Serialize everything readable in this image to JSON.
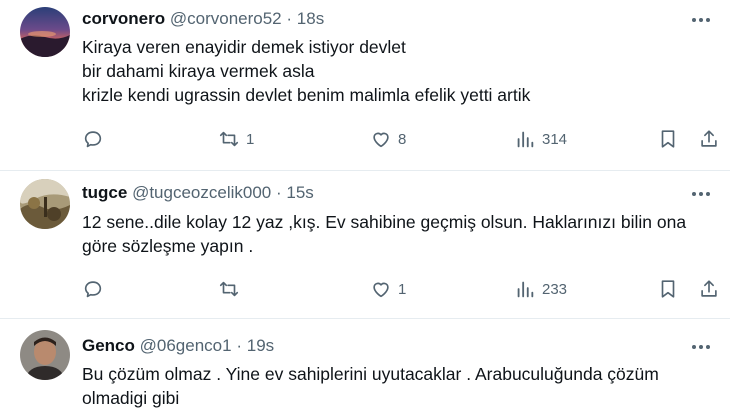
{
  "tweets": [
    {
      "name": "corvonero",
      "handle": "@corvonero52",
      "separator": "·",
      "time": "18s",
      "lines": [
        "Kiraya veren enayidir demek istiyor devlet",
        "bir dahami kiraya vermek asla",
        "krizle kendi ugrassin devlet benim malimla efelik yetti artik"
      ],
      "reply_count": "",
      "retweet_count": "1",
      "like_count": "8",
      "view_count": "314"
    },
    {
      "name": "tugce",
      "handle": "@tugceozcelik000",
      "separator": "·",
      "time": "15s",
      "text": "12 sene..dile kolay 12 yaz ,kış. Ev sahibine geçmiş olsun. Haklarınızı bilin ona göre sözleşme yapın .",
      "reply_count": "",
      "retweet_count": "",
      "like_count": "1",
      "view_count": "233"
    },
    {
      "name": "Genco",
      "handle": "@06genco1",
      "separator": "·",
      "time": "19s",
      "text": "Bu çözüm olmaz . Yine ev sahiplerini uyutacaklar . Arabuculuğunda çözüm olmadigi gibi"
    }
  ],
  "icons": {
    "reply": "reply-icon",
    "retweet": "retweet-icon",
    "like": "heart-icon",
    "views": "views-icon",
    "bookmark": "bookmark-icon",
    "share": "share-icon",
    "more": "more-icon"
  },
  "colors": {
    "text": "#0f1419",
    "secondary": "#536471",
    "divider": "#e6ecf0"
  }
}
